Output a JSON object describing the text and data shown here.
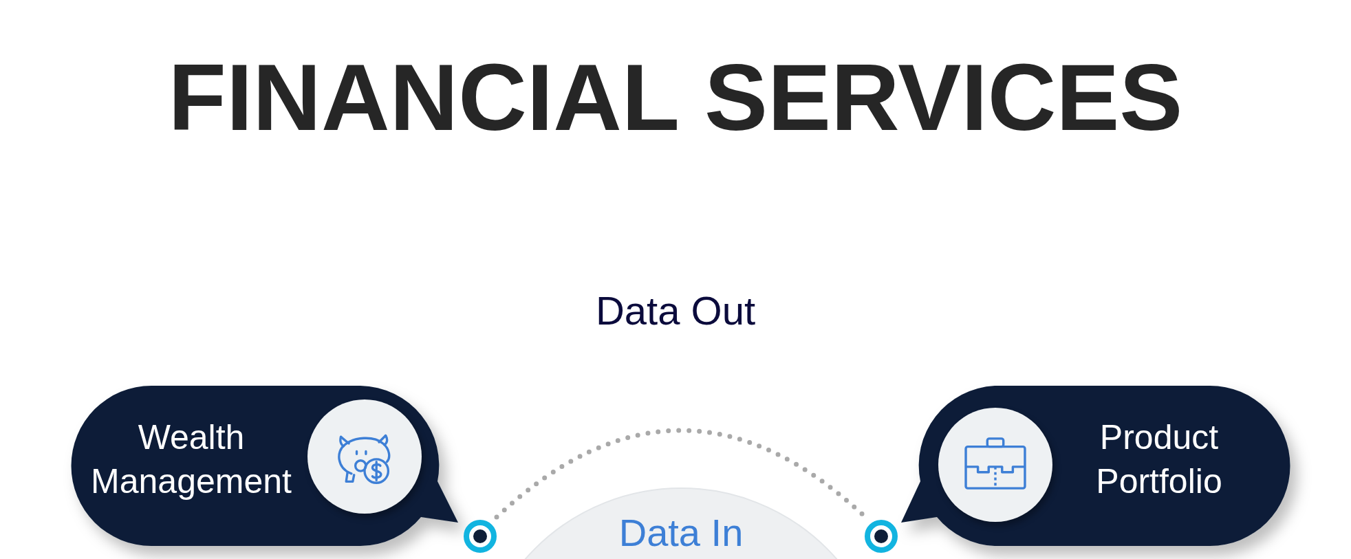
{
  "title": "FINANCIAL SERVICES",
  "diagram": {
    "top_label": "Data Out",
    "center_label": "Data In",
    "callouts": [
      {
        "label": "Wealth Management",
        "kind": "left"
      },
      {
        "label": "Product Portfolio",
        "kind": "right"
      }
    ]
  }
}
